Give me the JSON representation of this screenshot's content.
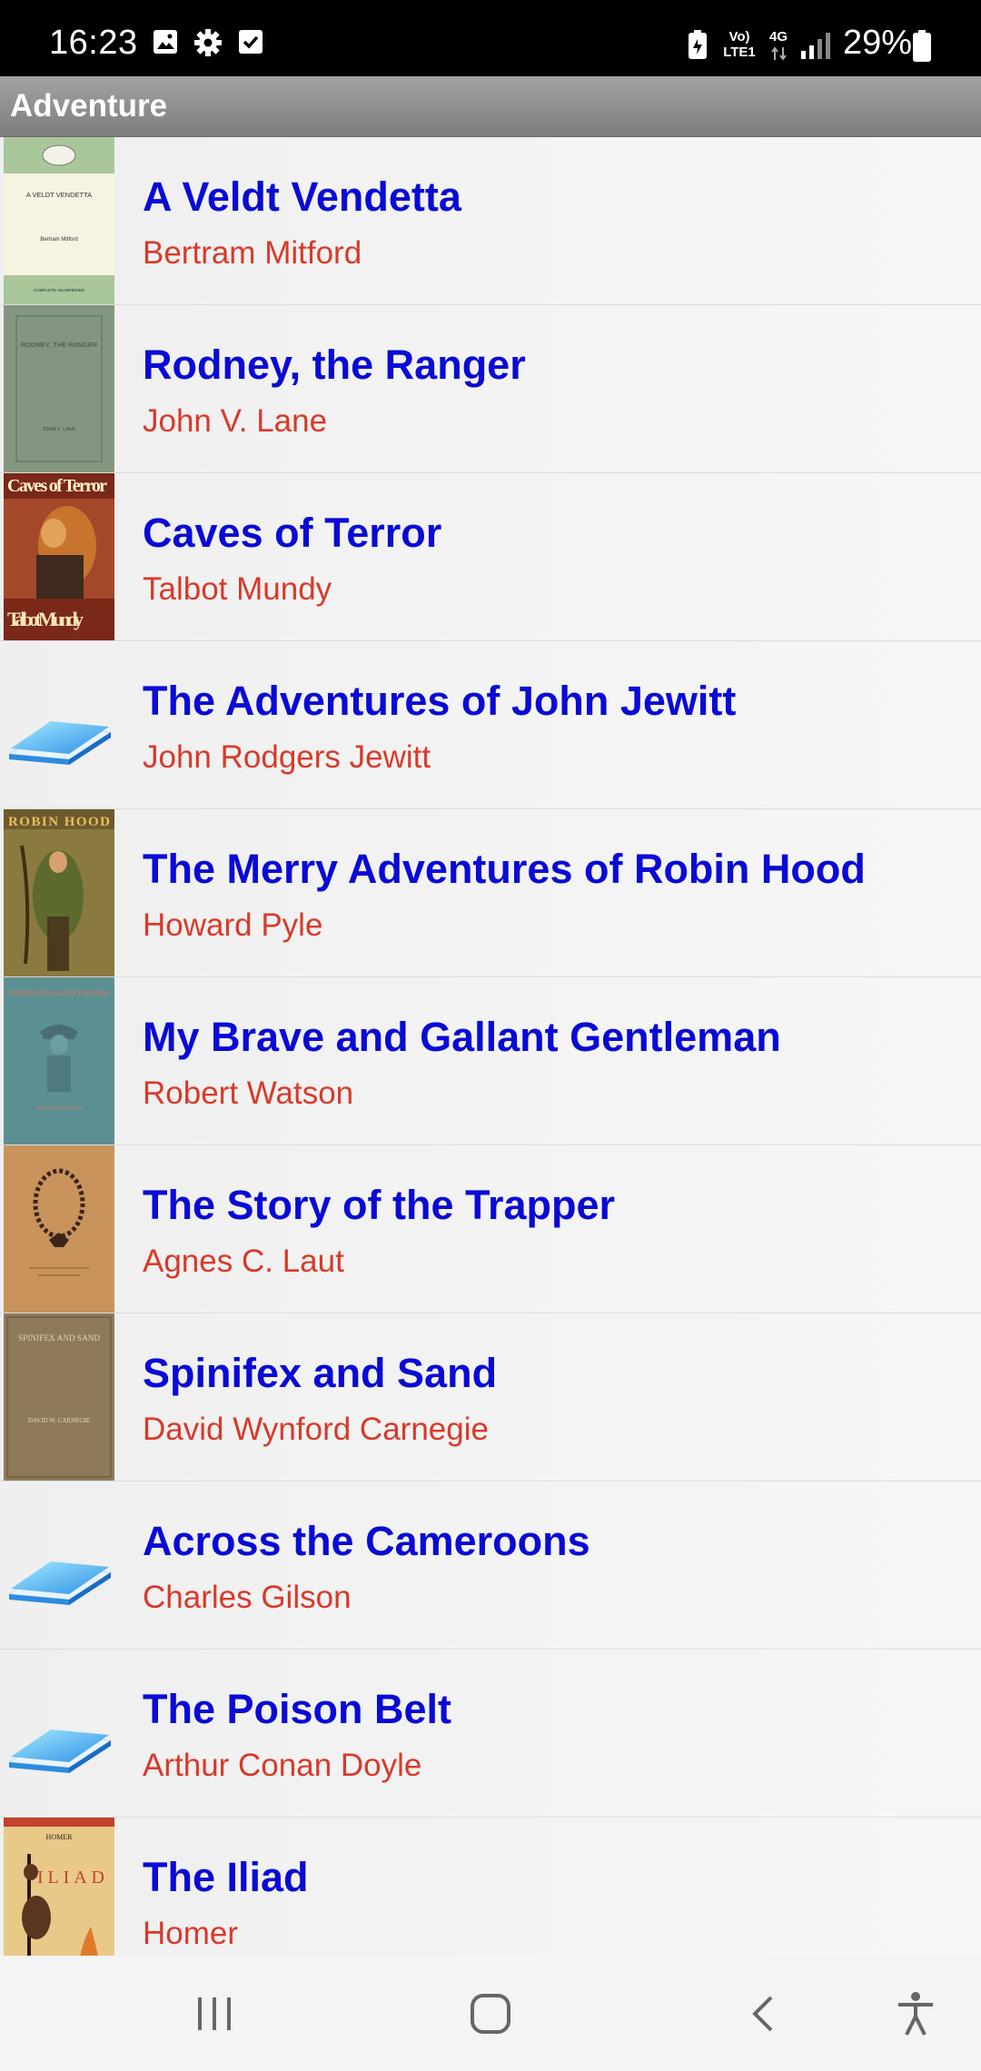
{
  "status_bar": {
    "time": "16:23",
    "left_icons": [
      "gallery-icon",
      "gear-icon",
      "checkbox-icon"
    ],
    "network_top": "Vo)",
    "network_bottom": "LTE1",
    "network_type": "4G",
    "battery_percent": "29%"
  },
  "header": {
    "title": "Adventure"
  },
  "books": [
    {
      "title": "A Veldt Vendetta",
      "author": "Bertram Mitford",
      "cover": "veldt-vendetta-cover"
    },
    {
      "title": "Rodney, the Ranger",
      "author": "John V. Lane",
      "cover": "rodney-ranger-cover"
    },
    {
      "title": "Caves of Terror",
      "author": "Talbot Mundy",
      "cover": "caves-of-terror-cover"
    },
    {
      "title": "The Adventures of John Jewitt",
      "author": "John Rodgers Jewitt",
      "cover": "generic-book-icon"
    },
    {
      "title": "The Merry Adventures of Robin Hood",
      "author": "Howard Pyle",
      "cover": "robin-hood-cover"
    },
    {
      "title": "My Brave and Gallant Gentleman",
      "author": "Robert Watson",
      "cover": "gallant-gentleman-cover"
    },
    {
      "title": "The Story of the Trapper",
      "author": "Agnes C. Laut",
      "cover": "story-of-trapper-cover"
    },
    {
      "title": "Spinifex and Sand",
      "author": "David Wynford Carnegie",
      "cover": "spinifex-sand-cover"
    },
    {
      "title": "Across the Cameroons",
      "author": "Charles Gilson",
      "cover": "generic-book-icon"
    },
    {
      "title": "The Poison Belt",
      "author": "Arthur Conan Doyle",
      "cover": "generic-book-icon"
    },
    {
      "title": "The Iliad",
      "author": "Homer",
      "cover": "iliad-cover"
    }
  ],
  "covers_text": {
    "veldt": {
      "title": "A VELDT VENDETTA",
      "author": "Bertram Mitford",
      "footer": "COMPLETE UNABRIDGED"
    },
    "rodney": {
      "title": "RODNEY, THE RANGER",
      "author": "JOHN V. LANE"
    },
    "caves": {
      "title": "Caves of Terror",
      "author": "Talbot Mundy"
    },
    "robin": {
      "title": "ROBIN HOOD"
    },
    "gallant": {
      "title": "MY BRAVE AND GALLANT GENTLEMAN",
      "author": "ROBERT WATSON"
    },
    "spinifex": {
      "title": "SPINIFEX AND SAND",
      "author": "DAVID W. CARNEGIE"
    },
    "iliad": {
      "title": "ILIAD",
      "author": "HOMER"
    }
  },
  "nav_bar": {
    "buttons": [
      "recent-apps",
      "home",
      "back",
      "accessibility"
    ]
  }
}
